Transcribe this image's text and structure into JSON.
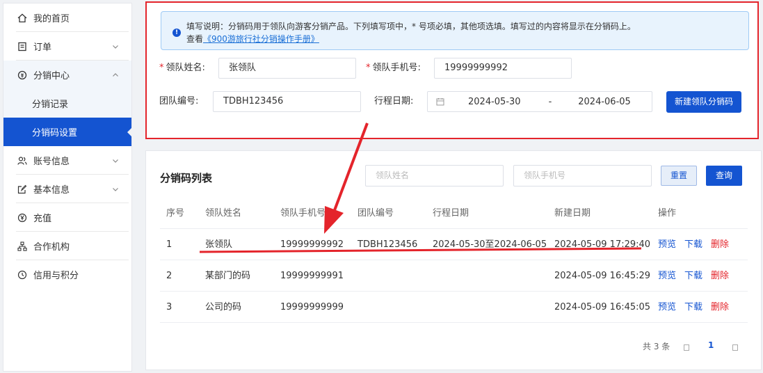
{
  "sidebar": {
    "items": [
      {
        "label": "我的首页"
      },
      {
        "label": "订单"
      },
      {
        "label": "分销中心"
      },
      {
        "label": "分销记录"
      },
      {
        "label": "分销码设置"
      },
      {
        "label": "账号信息"
      },
      {
        "label": "基本信息"
      },
      {
        "label": "充值"
      },
      {
        "label": "合作机构"
      },
      {
        "label": "信用与积分"
      }
    ]
  },
  "notice": {
    "line1": "填写说明：分销码用于领队向游客分销产品。下列填写项中，* 号项必填，其他项选填。填写过的内容将显示在分销码上。",
    "see": "查看",
    "link": "《900游旅行社分销操作手册》"
  },
  "form": {
    "leader_name_label": "领队姓名:",
    "leader_name_value": "张领队",
    "leader_phone_label": "领队手机号:",
    "leader_phone_value": "19999999992",
    "group_no_label": "团队编号:",
    "group_no_value": "TDBH123456",
    "trip_date_label": "行程日期:",
    "date_start": "2024-05-30",
    "date_sep": "-",
    "date_end": "2024-06-05",
    "create_button": "新建领队分销码",
    "required_mark": "*"
  },
  "list": {
    "title": "分销码列表",
    "search_name_placeholder": "领队姓名",
    "search_phone_placeholder": "领队手机号",
    "reset_button": "重置",
    "query_button": "查询",
    "columns": [
      "序号",
      "领队姓名",
      "领队手机号",
      "团队编号",
      "行程日期",
      "新建日期",
      "操作"
    ],
    "rows": [
      {
        "no": "1",
        "name": "张领队",
        "phone": "19999999992",
        "group": "TDBH123456",
        "trip": "2024-05-30至2024-06-05",
        "created": "2024-05-09 17:29:40"
      },
      {
        "no": "2",
        "name": "某部门的码",
        "phone": "19999999991",
        "group": "",
        "trip": "",
        "created": "2024-05-09 16:45:29"
      },
      {
        "no": "3",
        "name": "公司的码",
        "phone": "19999999999",
        "group": "",
        "trip": "",
        "created": "2024-05-09 16:45:05"
      }
    ],
    "actions": {
      "preview": "预览",
      "download": "下载",
      "delete": "删除"
    },
    "pagination": {
      "total": "共 3 条",
      "current_page": "1"
    }
  },
  "colors": {
    "primary": "#1454d1",
    "annotation_red": "#e4242b",
    "notice_bg": "#e8f3fd"
  }
}
